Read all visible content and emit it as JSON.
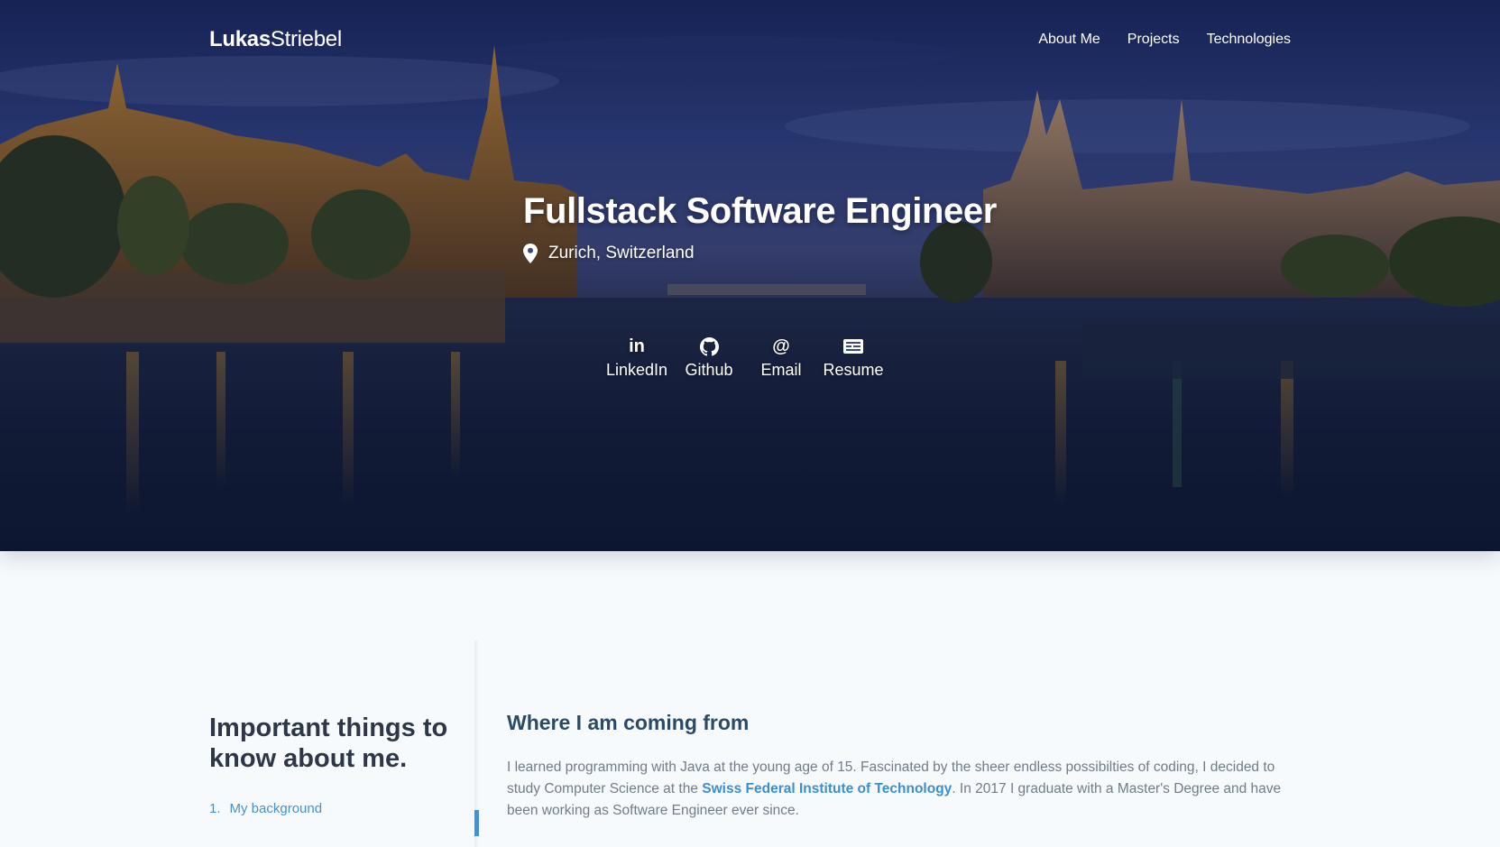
{
  "brand": {
    "first": "Lukas",
    "last": "Striebel"
  },
  "nav": {
    "items": [
      {
        "label": "About Me"
      },
      {
        "label": "Projects"
      },
      {
        "label": "Technologies"
      }
    ]
  },
  "hero": {
    "title": "Fullstack Software Engineer",
    "location": "Zurich, Switzerland",
    "links": [
      {
        "label": "LinkedIn",
        "icon": "linkedin-icon"
      },
      {
        "label": "Github",
        "icon": "github-icon"
      },
      {
        "label": "Email",
        "icon": "at-sign-icon"
      },
      {
        "label": "Resume",
        "icon": "resume-icon"
      }
    ],
    "linkedin_glyph": "in",
    "email_glyph": "@"
  },
  "about": {
    "title_line1": "Important things to",
    "title_line2": "know about me.",
    "toc": [
      {
        "number": "1.",
        "label": "My background"
      }
    ],
    "section_heading": "Where I am coming from",
    "paragraph_before": "I learned programming with Java at the young age of 15. Fascinated by the sheer endless possibilties of coding, I decided to study Computer Science at the ",
    "paragraph_link": "Swiss Federal Institute of Technology",
    "paragraph_after": ". In 2017 I graduate with a Master's Degree and have been working as Software Engineer ever since."
  },
  "colors": {
    "accent": "#4a90d0",
    "heading": "#2d3748",
    "body_text": "#717c88",
    "page_background": "#f7fafc"
  }
}
